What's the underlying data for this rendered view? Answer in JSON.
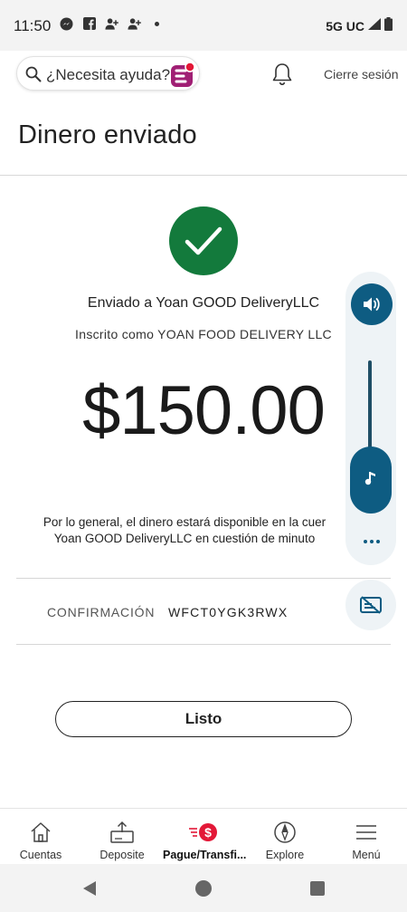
{
  "status_bar": {
    "time": "11:50",
    "network": "5G UC",
    "notification_icons": [
      "messenger-icon",
      "facebook-icon",
      "person-add-icon",
      "person-add-icon",
      "dot-icon"
    ]
  },
  "header": {
    "help_text": "¿Necesita ayuda?",
    "logout_label": "Cierre sesión"
  },
  "page": {
    "title": "Dinero enviado"
  },
  "confirmation_screen": {
    "sent_to": "Enviado a Yoan GOOD DeliveryLLC",
    "registered_as": "Inscrito como YOAN FOOD DELIVERY LLC",
    "amount": "$150.00",
    "availability_line1": "Por lo general, el dinero estará disponible en la cuer",
    "availability_line2": "Yoan GOOD DeliveryLLC en cuestión de minuto",
    "confirmation_label": "CONFIRMACIÓN",
    "confirmation_value": "WFCT0YGK3RWX",
    "done_label": "Listo",
    "success_color": "#137a3c"
  },
  "volume_overlay": {
    "accent_color": "#0e5c82",
    "level": 0.3
  },
  "bottom_nav": {
    "items": [
      {
        "label": "Cuentas",
        "icon": "home-icon"
      },
      {
        "label": "Deposite",
        "icon": "deposit-icon"
      },
      {
        "label": "Pague/Transfi...",
        "icon": "pay-transfer-icon",
        "active": true
      },
      {
        "label": "Explore",
        "icon": "compass-icon"
      },
      {
        "label": "Menú",
        "icon": "menu-icon"
      }
    ],
    "active_color": "#e31837"
  }
}
